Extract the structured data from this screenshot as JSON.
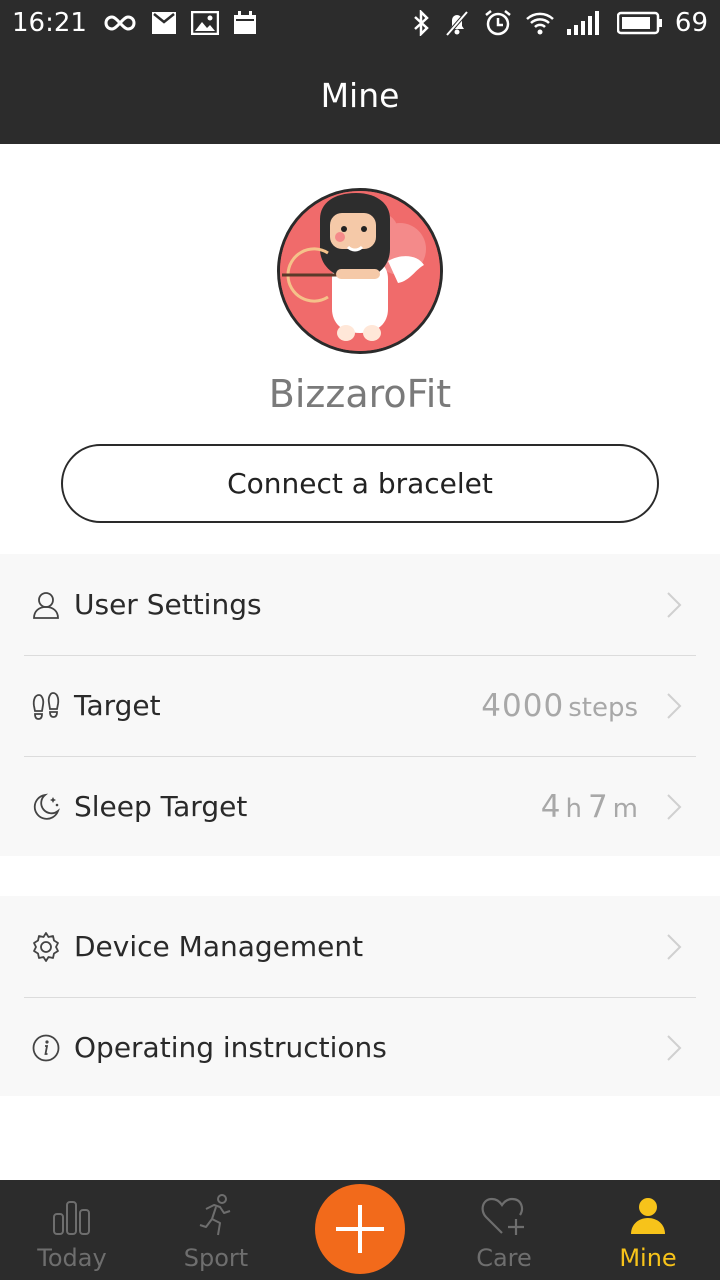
{
  "status_bar": {
    "time": "16:21",
    "battery": "69",
    "icons": [
      "infinity-icon",
      "mail-icon",
      "image-icon",
      "calendar-icon",
      "bluetooth-icon",
      "bell-off-icon",
      "alarm-icon",
      "wifi-icon",
      "signal-icon",
      "battery-icon"
    ]
  },
  "header": {
    "title": "Mine"
  },
  "profile": {
    "name": "BizzaroFit",
    "connect_label": "Connect a bracelet",
    "avatar_icon": "cupid-avatar"
  },
  "list_primary": [
    {
      "label": "User Settings",
      "icon": "user-icon"
    },
    {
      "label": "Target",
      "icon": "footprints-icon",
      "value": "4000",
      "unit": "steps"
    },
    {
      "label": "Sleep Target",
      "icon": "moon-icon",
      "hours": "4",
      "hours_unit": "h",
      "minutes": "7",
      "minutes_unit": "m"
    }
  ],
  "list_secondary": [
    {
      "label": "Device Management",
      "icon": "gear-icon"
    },
    {
      "label": "Operating instructions",
      "icon": "info-icon"
    }
  ],
  "bottom_nav": {
    "items": [
      {
        "label": "Today",
        "icon": "bar-chart-icon"
      },
      {
        "label": "Sport",
        "icon": "runner-icon"
      },
      {
        "label": "",
        "icon": "plus-icon"
      },
      {
        "label": "Care",
        "icon": "heart-plus-icon"
      },
      {
        "label": "Mine",
        "icon": "person-icon",
        "active": true
      }
    ]
  },
  "colors": {
    "header_bg": "#2c2c2c",
    "accent_orange": "#f26a1b",
    "active_yellow": "#f7c31a",
    "list_bg": "#f8f8f8"
  }
}
